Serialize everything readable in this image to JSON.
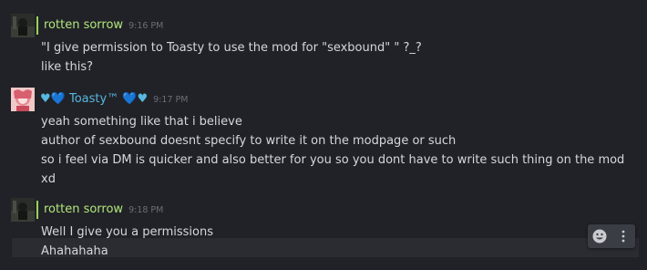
{
  "messages": [
    {
      "author": "rotten sorrow",
      "time": "9:16 PM",
      "lines": [
        "\"I give permission to Toasty to use the mod for \"sexbound\" \" ?_?",
        "like this?"
      ]
    },
    {
      "author": "♥💙 Toasty™ 💙♥",
      "time": "9:17 PM",
      "lines": [
        "yeah something like that i believe",
        "author of sexbound doesnt specify to write it on the modpage or such",
        "so i feel via DM is quicker and also better for you so you dont have to write such thing on the mod xd"
      ]
    },
    {
      "author": "rotten sorrow",
      "time": "9:18 PM",
      "lines": [
        "Well I give you a permissions",
        "Ahahahaha"
      ]
    }
  ],
  "hover_actions": {
    "emoji_icon": "emoji-reaction-icon",
    "more_icon": "more-options-icon"
  },
  "colors": {
    "background": "#202227",
    "rotten_name": "#b3e57b",
    "toasty_name": "#58b7e0",
    "text": "#d5d7dc",
    "timestamp": "#6b6e75"
  }
}
